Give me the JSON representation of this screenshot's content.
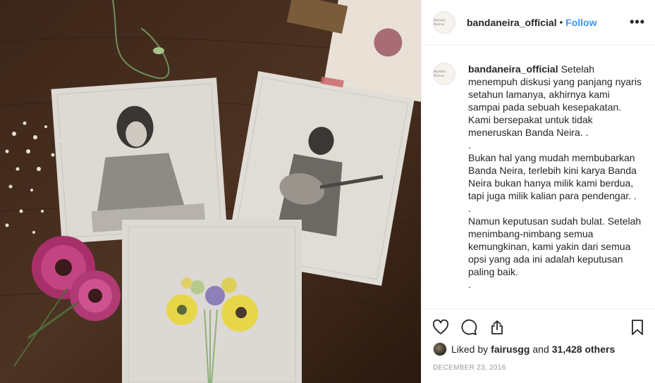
{
  "post": {
    "username": "bandaneira_official",
    "separator": "•",
    "follow_label": "Follow",
    "more_icon": "more-options-icon",
    "avatar_mark": "Banda Neira"
  },
  "caption": {
    "username": "bandaneira_official",
    "paragraphs": [
      "Setelah menempuh diskusi yang panjang nyaris setahun lamanya, akhirnya kami sampai pada sebuah kesepakatan. Kami bersepakat untuk tidak meneruskan Banda Neira. .",
      ".",
      "Bukan hal yang mudah membubarkan Banda Neira, terlebih kini karya Banda Neira bukan hanya milik kami berdua, tapi juga milik kalian para pendengar. .",
      ".",
      "Namun keputusan sudah bulat. Setelah menimbang-nimbang semua kemungkinan, kami yakin dari semua opsi yang ada ini adalah keputusan paling baik.",
      "."
    ]
  },
  "actions": {
    "like_icon": "heart-icon",
    "comment_icon": "comment-icon",
    "share_icon": "share-icon",
    "save_icon": "bookmark-icon"
  },
  "likes": {
    "prefix": "Liked by",
    "user": "fairusgg",
    "and": "and",
    "count": "31,428 others"
  },
  "date": "DECEMBER 23, 2016",
  "colors": {
    "follow": "#3897f0",
    "text": "#262626",
    "muted": "#999999",
    "divider": "#efefef"
  }
}
